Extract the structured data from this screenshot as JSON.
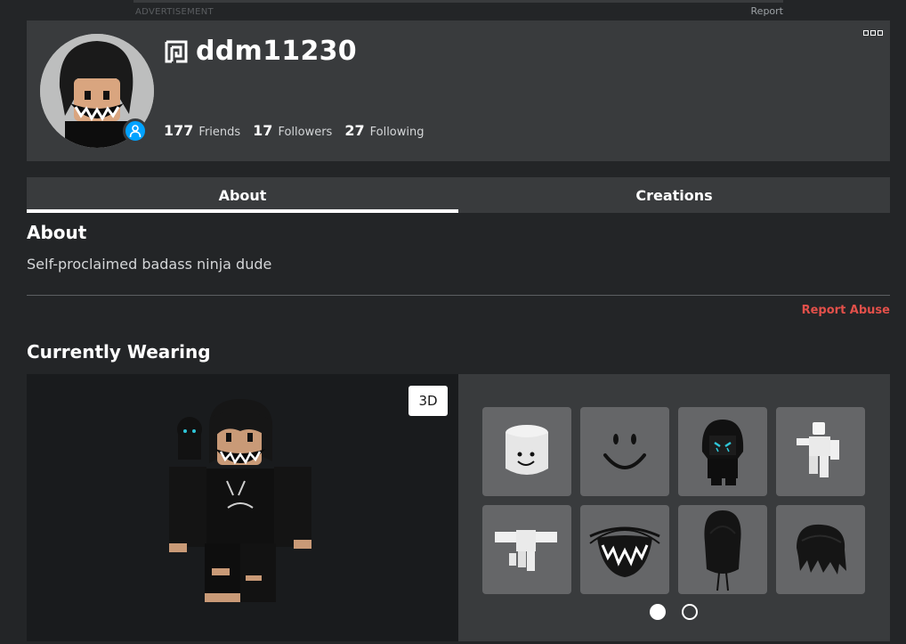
{
  "top_bar": {
    "ad_label": "ADVERTISEMENT",
    "report_label": "Report"
  },
  "profile": {
    "username": "ddm11230",
    "stats": [
      {
        "count": "177",
        "label": "Friends"
      },
      {
        "count": "17",
        "label": "Followers"
      },
      {
        "count": "27",
        "label": "Following"
      }
    ],
    "presence_color": "#00a2ff"
  },
  "tabs": [
    {
      "label": "About",
      "active": true
    },
    {
      "label": "Creations",
      "active": false
    }
  ],
  "about": {
    "title": "About",
    "description": "Self-proclaimed badass ninja dude",
    "report_abuse": "Report Abuse"
  },
  "wearing": {
    "title": "Currently Wearing",
    "view_toggle": "3D",
    "items": [
      {
        "name": "head-item",
        "icon": "white-block-head"
      },
      {
        "name": "face-item",
        "icon": "smile-face"
      },
      {
        "name": "hooded-figure-item",
        "icon": "black-hood-figure"
      },
      {
        "name": "animation-pose-item",
        "icon": "white-figure-pose"
      },
      {
        "name": "animation-run-item",
        "icon": "white-figure-run"
      },
      {
        "name": "mask-item",
        "icon": "teeth-mask"
      },
      {
        "name": "hood-accessory-item",
        "icon": "black-hood"
      },
      {
        "name": "hair-item",
        "icon": "black-hair"
      }
    ],
    "page": 1,
    "page_count": 2
  },
  "colors": {
    "background": "#232527",
    "card": "#393b3d",
    "accent_red": "#e2504a"
  }
}
